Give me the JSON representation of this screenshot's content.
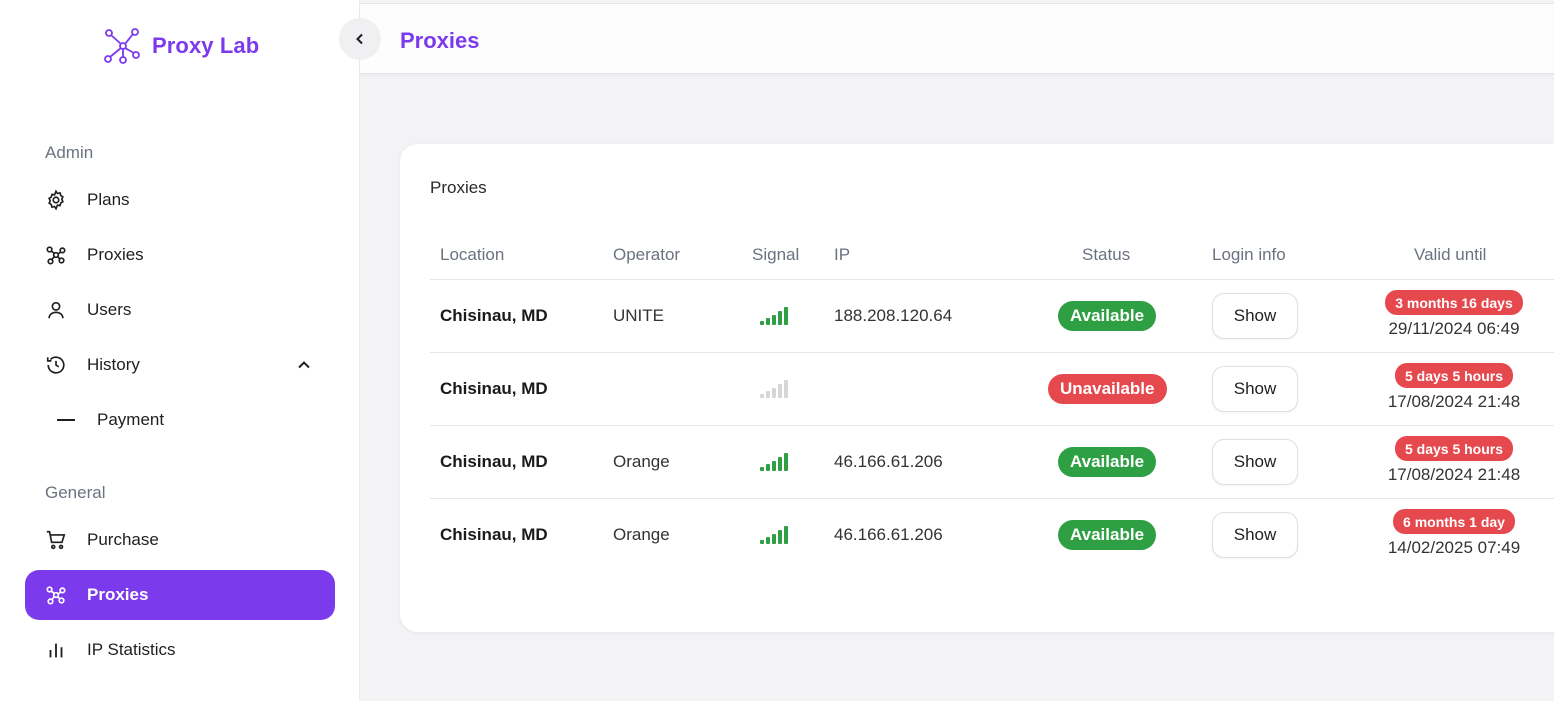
{
  "brand": {
    "name": "Proxy Lab",
    "accent": "#7c3aed"
  },
  "header": {
    "title": "Proxies"
  },
  "sidebar": {
    "admin_label": "Admin",
    "admin_items": [
      {
        "label": "Plans",
        "icon": "gear-icon"
      },
      {
        "label": "Proxies",
        "icon": "proxy-nodes-icon"
      },
      {
        "label": "Users",
        "icon": "user-icon"
      },
      {
        "label": "History",
        "icon": "history-icon",
        "expanded": true
      }
    ],
    "history_sub": [
      {
        "label": "Payment"
      }
    ],
    "general_label": "General",
    "general_items": [
      {
        "label": "Purchase",
        "icon": "cart-icon"
      },
      {
        "label": "Proxies",
        "icon": "proxy-nodes-icon",
        "active": true
      },
      {
        "label": "IP Statistics",
        "icon": "bar-chart-icon"
      }
    ]
  },
  "card": {
    "title": "Proxies",
    "columns": [
      "Location",
      "Operator",
      "Signal",
      "IP",
      "Status",
      "Login info",
      "Valid until"
    ],
    "rows": [
      {
        "location": "Chisinau, MD",
        "operator": "UNITE",
        "signal_active": true,
        "ip": "188.208.120.64",
        "status": "Available",
        "status_ok": true,
        "login": "Show",
        "remaining": "3 months 16 days",
        "valid_until": "29/11/2024 06:49"
      },
      {
        "location": "Chisinau, MD",
        "operator": "",
        "signal_active": false,
        "ip": "",
        "status": "Unavailable",
        "status_ok": false,
        "login": "Show",
        "remaining": "5 days 5 hours",
        "valid_until": "17/08/2024 21:48"
      },
      {
        "location": "Chisinau, MD",
        "operator": "Orange",
        "signal_active": true,
        "ip": "46.166.61.206",
        "status": "Available",
        "status_ok": true,
        "login": "Show",
        "remaining": "5 days 5 hours",
        "valid_until": "17/08/2024 21:48"
      },
      {
        "location": "Chisinau, MD",
        "operator": "Orange",
        "signal_active": true,
        "ip": "46.166.61.206",
        "status": "Available",
        "status_ok": true,
        "login": "Show",
        "remaining": "6 months 1 day",
        "valid_until": "14/02/2025 07:49"
      }
    ]
  },
  "colors": {
    "available": "#2ea043",
    "unavailable": "#e5484d",
    "signal_off": "#d6d6d6"
  }
}
